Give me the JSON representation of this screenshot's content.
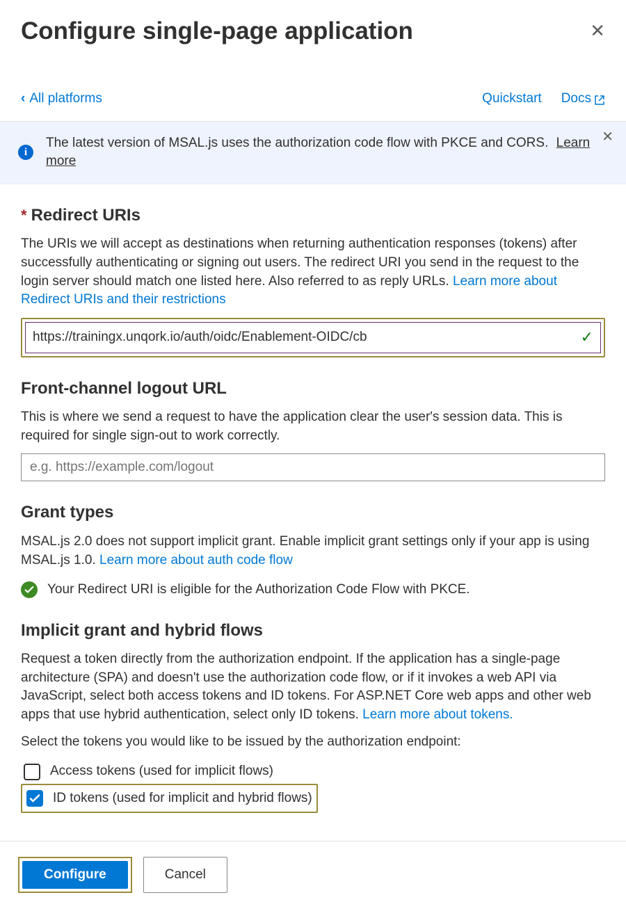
{
  "header": {
    "title": "Configure single-page application"
  },
  "subheader": {
    "back_label": "All platforms",
    "quickstart_label": "Quickstart",
    "docs_label": "Docs"
  },
  "banner": {
    "text": "The latest version of MSAL.js uses the authorization code flow with PKCE and CORS.",
    "learn_more": "Learn more"
  },
  "redirect": {
    "title": "Redirect URIs",
    "desc_part1": "The URIs we will accept as destinations when returning authentication responses (tokens) after successfully authenticating or signing out users. The redirect URI you send in the request to the login server should match one listed here. Also referred to as reply URLs. ",
    "learn_link": "Learn more about Redirect URIs and their restrictions",
    "input_value": "https://trainingx.unqork.io/auth/oidc/Enablement-OIDC/cb"
  },
  "logout": {
    "title": "Front-channel logout URL",
    "desc": "This is where we send a request to have the application clear the user's session data. This is required for single sign-out to work correctly.",
    "placeholder": "e.g. https://example.com/logout"
  },
  "grant": {
    "title": "Grant types",
    "desc_part1": "MSAL.js 2.0 does not support implicit grant. Enable implicit grant settings only if your app is using MSAL.js 1.0. ",
    "learn_link": "Learn more about auth code flow",
    "status_text": "Your Redirect URI is eligible for the Authorization Code Flow with PKCE."
  },
  "implicit": {
    "title": "Implicit grant and hybrid flows",
    "desc_part1": "Request a token directly from the authorization endpoint. If the application has a single-page architecture (SPA) and doesn't use the authorization code flow, or if it invokes a web API via JavaScript, select both access tokens and ID tokens. For ASP.NET Core web apps and other web apps that use hybrid authentication, select only ID tokens. ",
    "learn_link": "Learn more about tokens.",
    "select_prompt": "Select the tokens you would like to be issued by the authorization endpoint:",
    "access_label": "Access tokens (used for implicit flows)",
    "id_label": "ID tokens (used for implicit and hybrid flows)",
    "access_checked": false,
    "id_checked": true
  },
  "footer": {
    "configure_label": "Configure",
    "cancel_label": "Cancel"
  }
}
